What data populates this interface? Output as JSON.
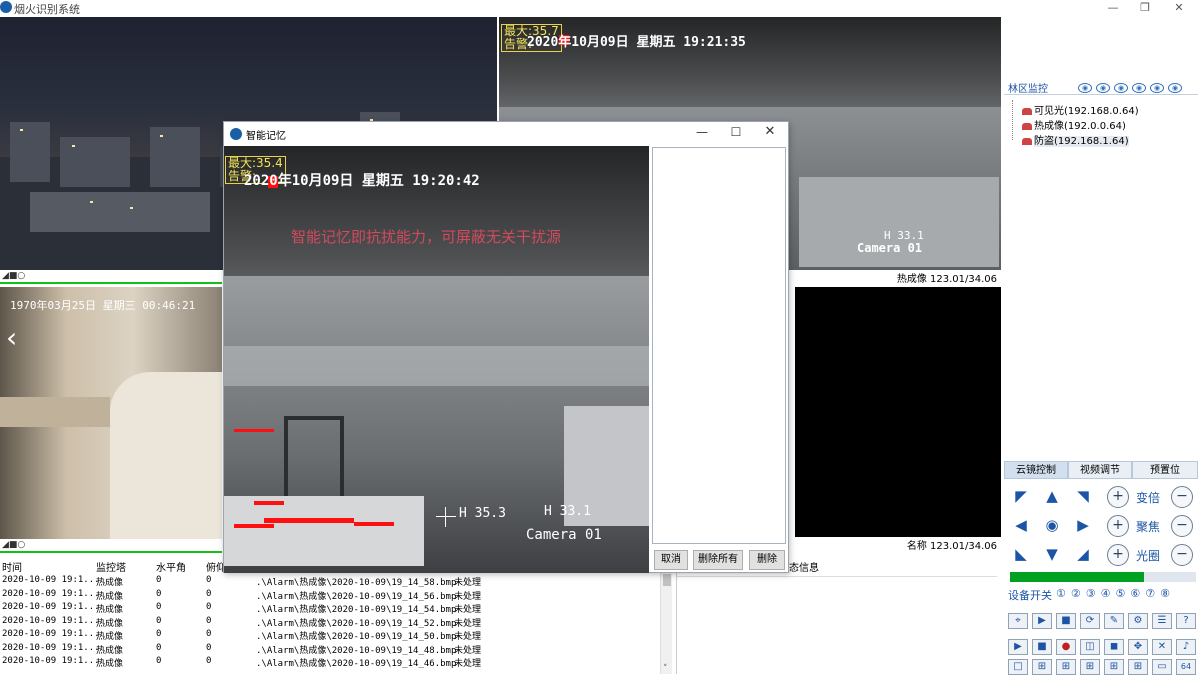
{
  "app": {
    "title": "烟火识别系统"
  },
  "panes": {
    "ir_top": {
      "osd_max": "最大:35.7",
      "osd_alarm": "告警:",
      "osd_datetime": "2020年10月09日  星期五  19:21:35",
      "h_label": "H 33.1",
      "camera": "Camera 01",
      "status": "热成像 123.01/34.06"
    },
    "left_bottom": {
      "datetime": "1970年03月25日  星期三  00:46:21"
    },
    "right_bottom": {
      "status": "名称 123.01/34.06"
    }
  },
  "right_panel": {
    "tree_title": "林区监控",
    "devices": [
      {
        "label": "可见光(192.168.0.64)"
      },
      {
        "label": "热成像(192.0.0.64)"
      },
      {
        "label": "防盗(192.168.1.64)"
      }
    ],
    "tabs": [
      "云镜控制",
      "视频调节",
      "预置位"
    ],
    "ptz_labels": {
      "zoom": "变倍",
      "focus": "聚焦",
      "iris": "光圈"
    },
    "device_switch": "设备开关",
    "switch_nums": [
      "①",
      "②",
      "③",
      "④",
      "⑤",
      "⑥",
      "⑦",
      "⑧"
    ],
    "progress": 0.72,
    "green": "#00a020"
  },
  "dialog": {
    "title": "智能记忆",
    "osd_max": "最大:35.4",
    "osd_alarm": "告警:",
    "osd_datetime": "2020年10月09日  星期五  19:20:42",
    "overlay_text": "智能记忆即抗扰能力，可屏蔽无关干扰源",
    "h_left": "H 35.3",
    "h_right": "H 33.1",
    "camera": "Camera 01",
    "buttons": {
      "cancel": "取消",
      "delete_all": "删除所有",
      "delete": "删除"
    }
  },
  "alarm_table": {
    "headers": [
      "时间",
      "监控塔",
      "水平角",
      "俯仰角"
    ],
    "rows": [
      {
        "time": "2020-10-09 19:1...",
        "tower": "热成像",
        "h": "0",
        "v": "0",
        "file": ".\\Alarm\\热成像\\2020-10-09\\19_14_58.bmp",
        "status": "未处理"
      },
      {
        "time": "2020-10-09 19:1...",
        "tower": "热成像",
        "h": "0",
        "v": "0",
        "file": ".\\Alarm\\热成像\\2020-10-09\\19_14_56.bmp",
        "status": "未处理"
      },
      {
        "time": "2020-10-09 19:1...",
        "tower": "热成像",
        "h": "0",
        "v": "0",
        "file": ".\\Alarm\\热成像\\2020-10-09\\19_14_54.bmp",
        "status": "未处理"
      },
      {
        "time": "2020-10-09 19:1...",
        "tower": "热成像",
        "h": "0",
        "v": "0",
        "file": ".\\Alarm\\热成像\\2020-10-09\\19_14_52.bmp",
        "status": "未处理"
      },
      {
        "time": "2020-10-09 19:1...",
        "tower": "热成像",
        "h": "0",
        "v": "0",
        "file": ".\\Alarm\\热成像\\2020-10-09\\19_14_50.bmp",
        "status": "未处理"
      },
      {
        "time": "2020-10-09 19:1...",
        "tower": "热成像",
        "h": "0",
        "v": "0",
        "file": ".\\Alarm\\热成像\\2020-10-09\\19_14_48.bmp",
        "status": "未处理"
      },
      {
        "time": "2020-10-09 19:1...",
        "tower": "热成像",
        "h": "0",
        "v": "0",
        "file": ".\\Alarm\\热成像\\2020-10-09\\19_14_46.bmp",
        "status": "未处理"
      }
    ]
  },
  "info_pane": {
    "title": "态信息"
  }
}
